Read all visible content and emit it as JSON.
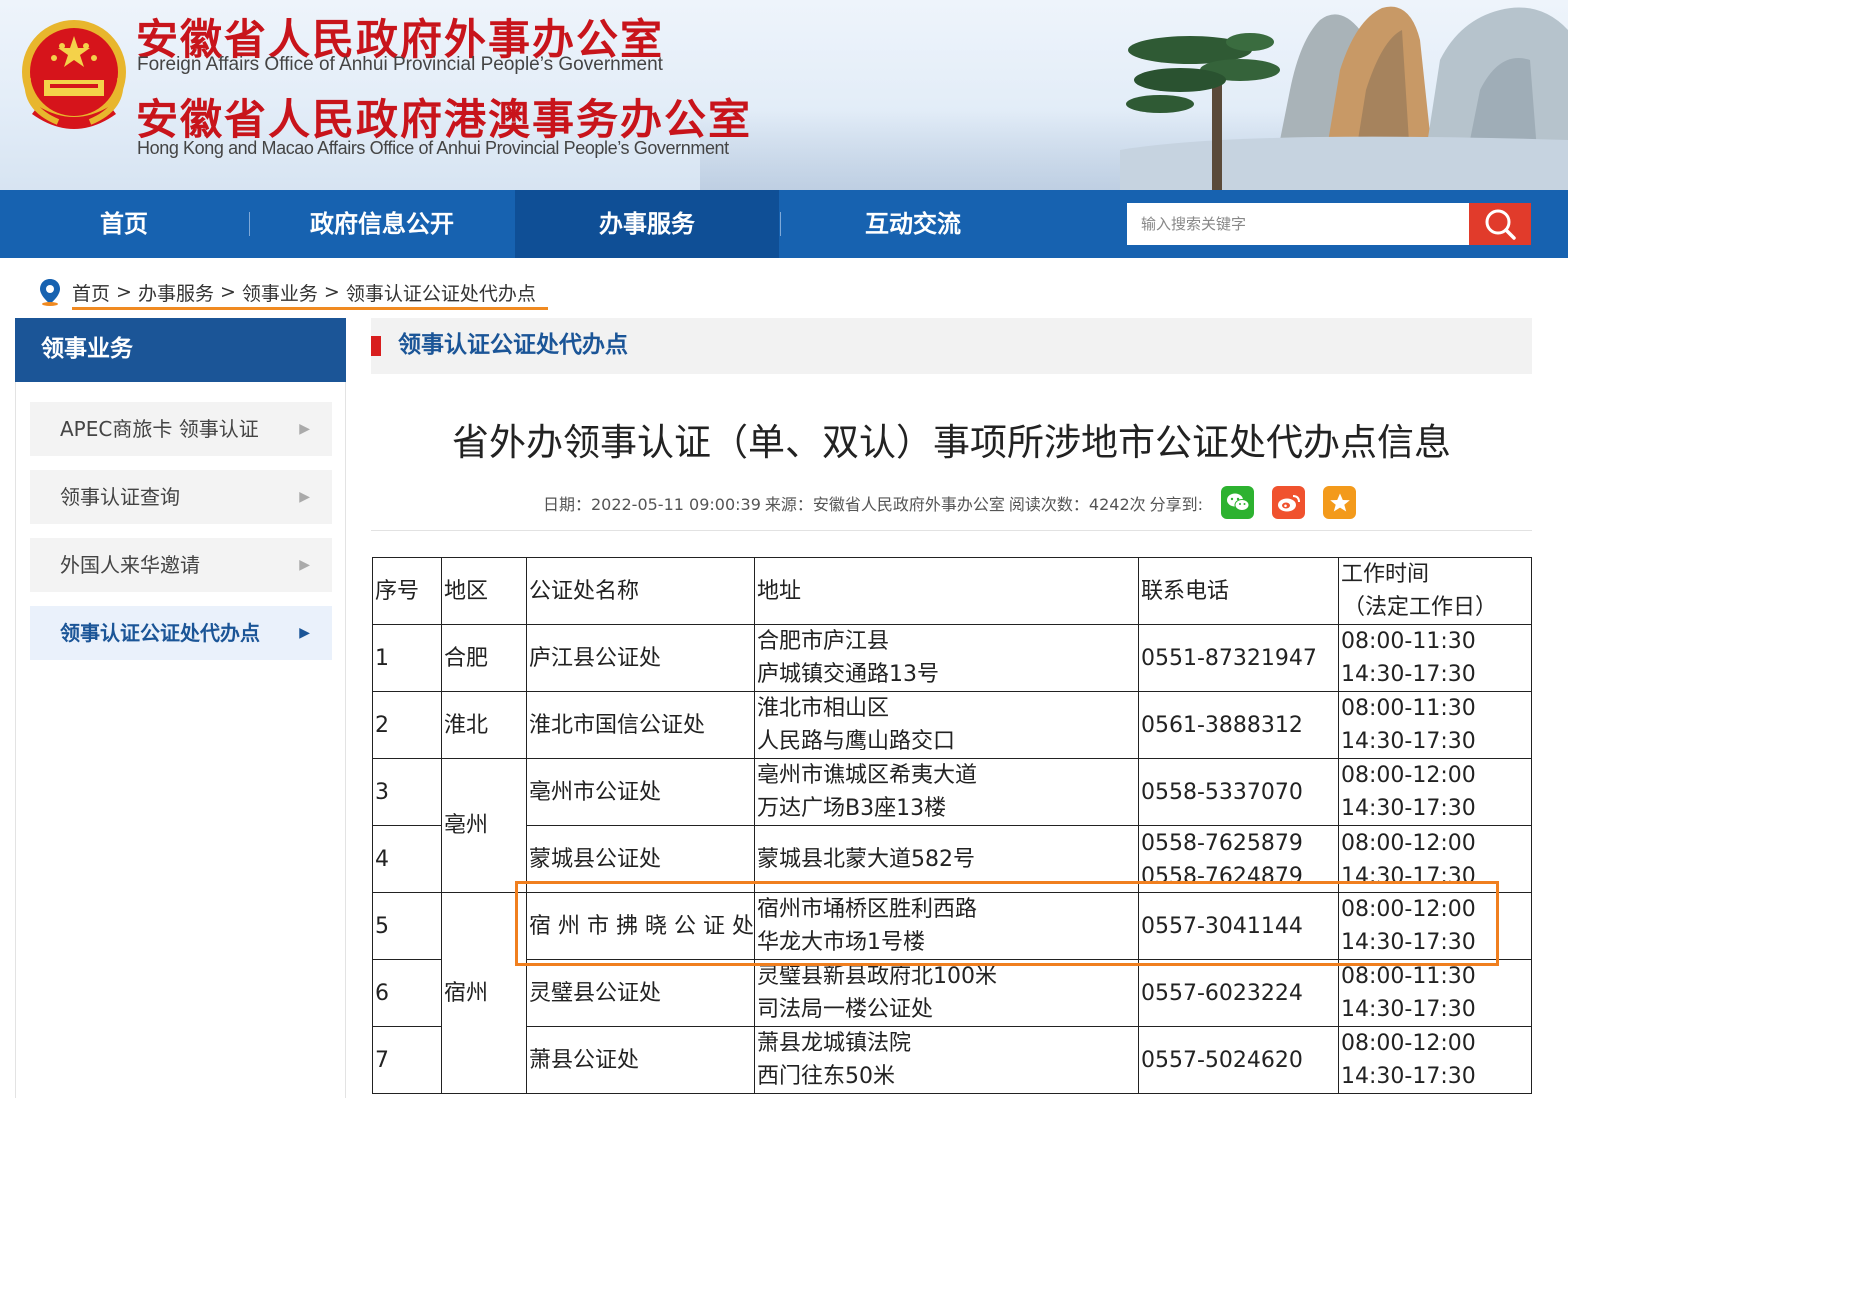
{
  "header": {
    "title_cn_1": "安徽省人民政府外事办公室",
    "title_en_1": "Foreign Affairs Office of Anhui Provincial People’s Government",
    "title_cn_2": "安徽省人民政府港澳事务办公室",
    "title_en_2": "Hong Kong and Macao Affairs Office of Anhui Provincial People’s Government"
  },
  "nav": {
    "items": [
      {
        "label": "首页"
      },
      {
        "label": "政府信息公开"
      },
      {
        "label": "办事服务"
      },
      {
        "label": "互动交流"
      }
    ],
    "active_index": 2,
    "search_placeholder": "输入搜索关键字"
  },
  "breadcrumb": {
    "items": [
      "首页",
      "办事服务",
      "领事业务",
      "领事认证公证处代办点"
    ],
    "separator": ">"
  },
  "sidebar": {
    "title": "领事业务",
    "items": [
      {
        "label": "APEC商旅卡 领事认证"
      },
      {
        "label": "领事认证查询"
      },
      {
        "label": "外国人来华邀请"
      },
      {
        "label": "领事认证公证处代办点"
      }
    ],
    "active_index": 3
  },
  "column": {
    "title": "领事认证公证处代办点"
  },
  "article": {
    "title": "省外办领事认证（单、双认）事项所涉地市公证处代办点信息",
    "date": "日期：2022-05-11 09:00:39",
    "source": "来源：安徽省人民政府外事办公室",
    "reads": "阅读次数：4242次",
    "share_label": "分享到:"
  },
  "table": {
    "headers": [
      "序号",
      "地区",
      "公证处名称",
      "地址",
      "联系电话",
      "工作时间",
      "（法定工作日）"
    ],
    "rows": [
      {
        "no": "1",
        "region": "合肥",
        "name": "庐江县公证处",
        "addr1": "合肥市庐江县",
        "addr2": "庐城镇交通路13号",
        "phone1": "0551-87321947",
        "phone2": "",
        "time1": "08:00-11:30",
        "time2": "14:30-17:30"
      },
      {
        "no": "2",
        "region": "淮北",
        "name": "淮北市国信公证处",
        "addr1": "淮北市相山区",
        "addr2": "人民路与鹰山路交口",
        "phone1": "0561-3888312",
        "phone2": "",
        "time1": "08:00-11:30",
        "time2": "14:30-17:30"
      },
      {
        "no": "3",
        "region": "亳州",
        "name": "亳州市公证处",
        "addr1": "亳州市谯城区希夷大道",
        "addr2": "万达广场B3座13楼",
        "phone1": "0558-5337070",
        "phone2": "",
        "time1": "08:00-12:00",
        "time2": "14:30-17:30"
      },
      {
        "no": "4",
        "region": "",
        "name": "蒙城县公证处",
        "addr1": "",
        "addr2": "蒙城县北蒙大道582号",
        "phone1": "0558-7625879",
        "phone2": "0558-7624879",
        "time1": "08:00-12:00",
        "time2": "14:30-17:30"
      },
      {
        "no": "5",
        "region": "宿州",
        "name": "宿 州 市 拂 晓 公 证 处",
        "addr1": "宿州市埇桥区胜利西路",
        "addr2": "华龙大市场1号楼",
        "phone1": "0557-3041144",
        "phone2": "",
        "time1": "08:00-12:00",
        "time2": "14:30-17:30"
      },
      {
        "no": "6",
        "region": "",
        "name": "灵璧县公证处",
        "addr1": "灵璧县新县政府北100米",
        "addr2": "司法局一楼公证处",
        "phone1": "0557-6023224",
        "phone2": "",
        "time1": "08:00-11:30",
        "time2": "14:30-17:30"
      },
      {
        "no": "7",
        "region": "",
        "name": "萧县公证处",
        "addr1": "萧县龙城镇法院",
        "addr2": "西门往东50米",
        "phone1": "0557-5024620",
        "phone2": "",
        "time1": "08:00-12:00",
        "time2": "14:30-17:30"
      }
    ]
  },
  "icons": {
    "location": "location-pin-icon",
    "search": "search-icon",
    "wechat": "wechat-icon",
    "weibo": "weibo-icon",
    "favorite": "star-icon",
    "emblem": "national-emblem-icon"
  },
  "colors": {
    "nav_bg": "#1762b0",
    "nav_active": "#0f4f96",
    "title_red": "#c8141b",
    "accent_blue": "#1b5597",
    "breadcrumb_underline": "#f08a21",
    "highlight_box": "#f07f1f",
    "search_btn": "#e13b2b"
  }
}
